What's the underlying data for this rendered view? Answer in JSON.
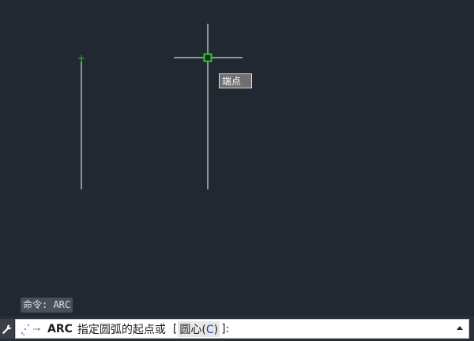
{
  "drawing": {
    "snap_tooltip": "端点"
  },
  "command_history": {
    "last_line": "命令: ARC"
  },
  "command_line": {
    "command": "ARC",
    "prompt": "指定圆弧的起点或",
    "bracket_open": "[",
    "option_prefix": "圆心(",
    "option_key": "C",
    "option_suffix": ")",
    "bracket_close": "]:",
    "customize_icon": "wrench-icon",
    "recent_commands_icon": "triangle-up-icon"
  },
  "colors": {
    "canvas_background": "#222831",
    "line": "#ffffff",
    "snap_marker": "#22cc22",
    "option_key": "#1a3fd0"
  }
}
